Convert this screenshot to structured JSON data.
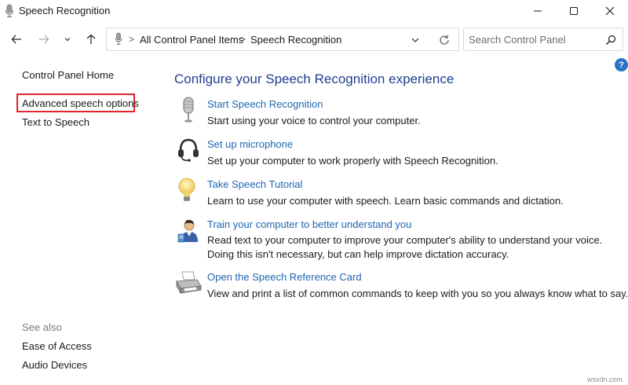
{
  "window": {
    "title": "Speech Recognition",
    "icon": "microphone-icon",
    "controls": [
      "minimize-icon",
      "maximize-icon",
      "close-icon"
    ]
  },
  "navbar": {
    "buttons": [
      "back-arrow-icon",
      "forward-arrow-icon",
      "recent-locations-chevron-icon",
      "up-arrow-icon"
    ],
    "address": {
      "icon": "microphone-icon",
      "crumbs": [
        "All Control Panel Items",
        "Speech Recognition"
      ],
      "separator": ">"
    },
    "search": {
      "placeholder": "Search Control Panel",
      "value": ""
    }
  },
  "help": {
    "label": "?"
  },
  "sidebar": {
    "links": [
      {
        "label": "Control Panel Home"
      },
      {
        "label": "Advanced speech options",
        "highlighted": true,
        "highlight_color": "#e0262c"
      },
      {
        "label": "Text to Speech"
      }
    ],
    "see_also": {
      "heading": "See also",
      "links": [
        {
          "label": "Ease of Access"
        },
        {
          "label": "Audio Devices"
        }
      ]
    }
  },
  "main": {
    "title": "Configure your Speech Recognition experience",
    "tasks": [
      {
        "icon": "microphone-icon",
        "link": "Start Speech Recognition",
        "description": [
          "Start using your voice to control your computer."
        ]
      },
      {
        "icon": "headset-icon",
        "link": "Set up microphone",
        "description": [
          "Set up your computer to work properly with Speech Recognition."
        ]
      },
      {
        "icon": "lightbulb-icon",
        "link": "Take Speech Tutorial",
        "description": [
          "Learn to use your computer with speech.  Learn basic commands and dictation."
        ]
      },
      {
        "icon": "user-training-icon",
        "link": "Train your computer to better understand you",
        "description": [
          "Read text to your computer to improve your computer's ability to understand your voice.",
          "Doing this isn't necessary, but can help improve dictation accuracy."
        ]
      },
      {
        "icon": "printer-icon",
        "link": "Open the Speech Reference Card",
        "description": [
          "View and print a list of common commands to keep with you so you always know what to say."
        ]
      }
    ]
  },
  "watermark": "wsxdn.com",
  "colors": {
    "link": "#1e66b3",
    "heading": "#1e3f8f",
    "highlight": "#e0262c",
    "help": "#2a73c5"
  }
}
